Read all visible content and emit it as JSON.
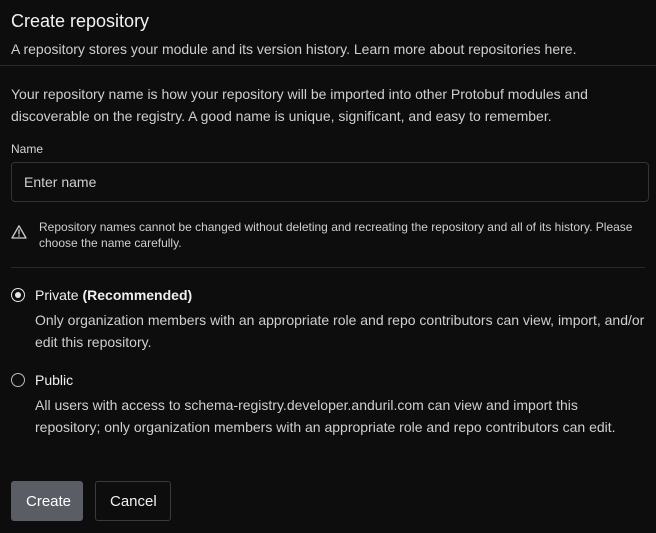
{
  "dialog": {
    "title": "Create repository",
    "subtitle": "A repository stores your module and its version history. Learn more about repositories here."
  },
  "intro": "Your repository name is how your repository will be imported into other Protobuf modules and discoverable on the registry. A good name is unique, significant, and easy to remember.",
  "name_field": {
    "label": "Name",
    "value": "",
    "placeholder": "Enter name"
  },
  "warning": {
    "icon": "warning-triangle-icon",
    "text": "Repository names cannot be changed without deleting and recreating the repository and all of its history. Please choose the name carefully."
  },
  "visibility": {
    "selected": "private",
    "options": [
      {
        "id": "private",
        "label": "Private",
        "label_suffix": "(Recommended)",
        "description": "Only organization members with an appropriate role and repo contributors can view, import, and/or edit this repository."
      },
      {
        "id": "public",
        "label": "Public",
        "label_suffix": "",
        "description": "All users with access to schema-registry.developer.anduril.com can view and import this repository; only organization members with an appropriate role and repo contributors can edit."
      }
    ]
  },
  "actions": {
    "create_label": "Create",
    "cancel_label": "Cancel"
  },
  "colors": {
    "background": "#0d0d0d",
    "primary_button": "#5a5d63",
    "border": "#333333"
  }
}
